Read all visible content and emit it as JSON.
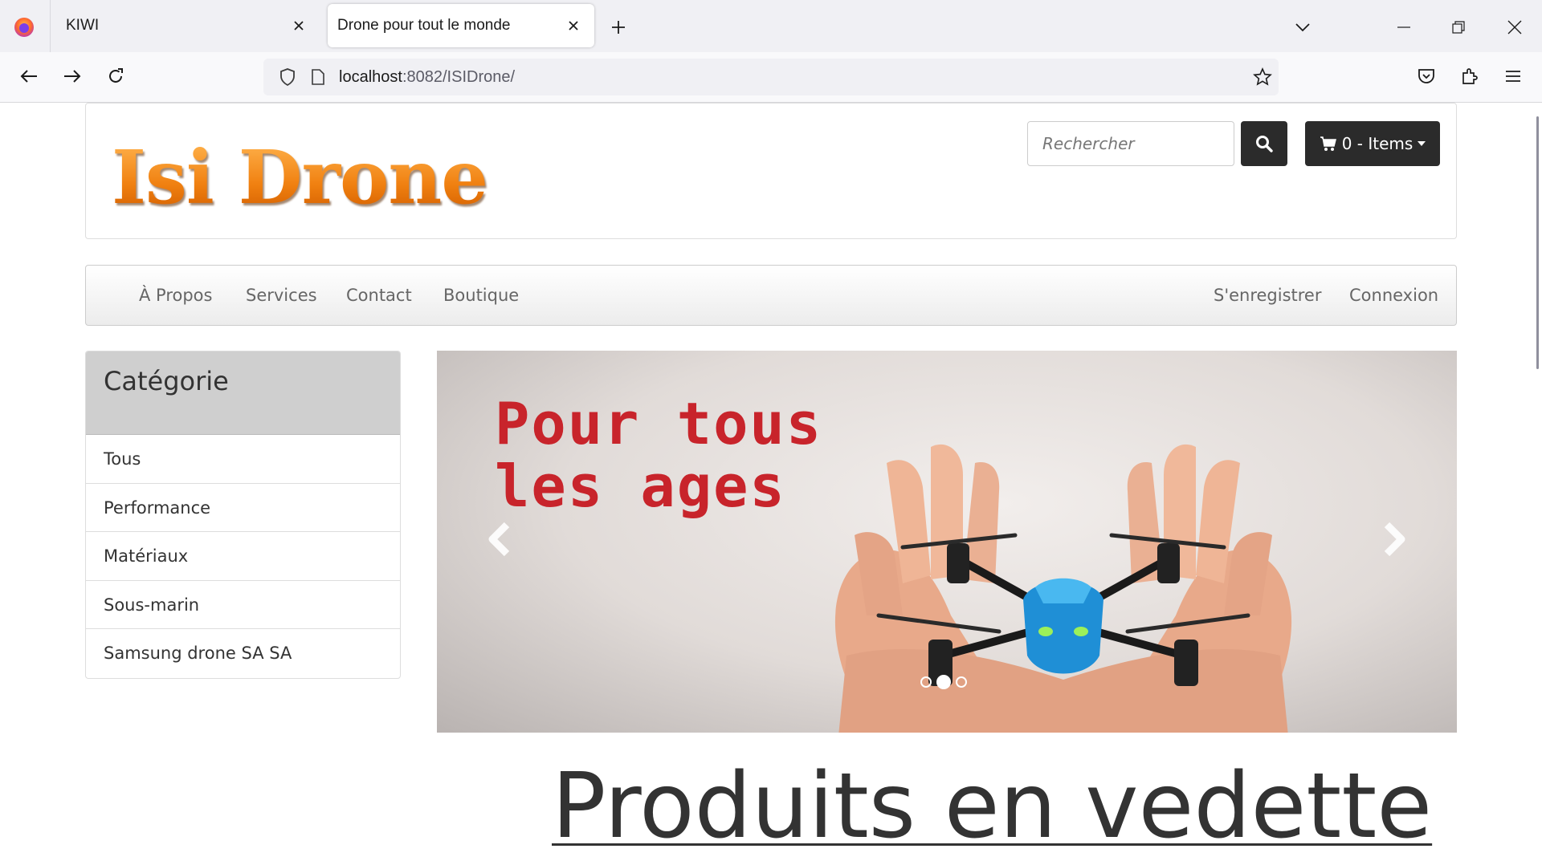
{
  "browser": {
    "tabs": [
      {
        "title": "KIWI",
        "active": false
      },
      {
        "title": "Drone pour tout le monde",
        "active": true
      }
    ],
    "url": {
      "host": "localhost",
      "rest": ":8082/ISIDrone/"
    }
  },
  "header": {
    "logo_text": "Isi Drone",
    "search_placeholder": "Rechercher",
    "cart_label": "0 - Items"
  },
  "menu": {
    "left": [
      "À Propos",
      "Services",
      "Contact",
      "Boutique"
    ],
    "right": [
      "S'enregistrer",
      "Connexion"
    ]
  },
  "sidebar": {
    "title": "Catégorie",
    "items": [
      "Tous",
      "Performance",
      "Matériaux",
      "Sous-marin",
      "Samsung drone SA SA"
    ]
  },
  "carousel": {
    "caption_line1": "Pour tous",
    "caption_line2": "les ages",
    "indicator_count": 3,
    "active_index": 1
  },
  "featured_title": "Produits en vedette",
  "colors": {
    "logo": "#f7941d",
    "caption": "#c8242b",
    "dark_button": "#2b2b2b"
  }
}
